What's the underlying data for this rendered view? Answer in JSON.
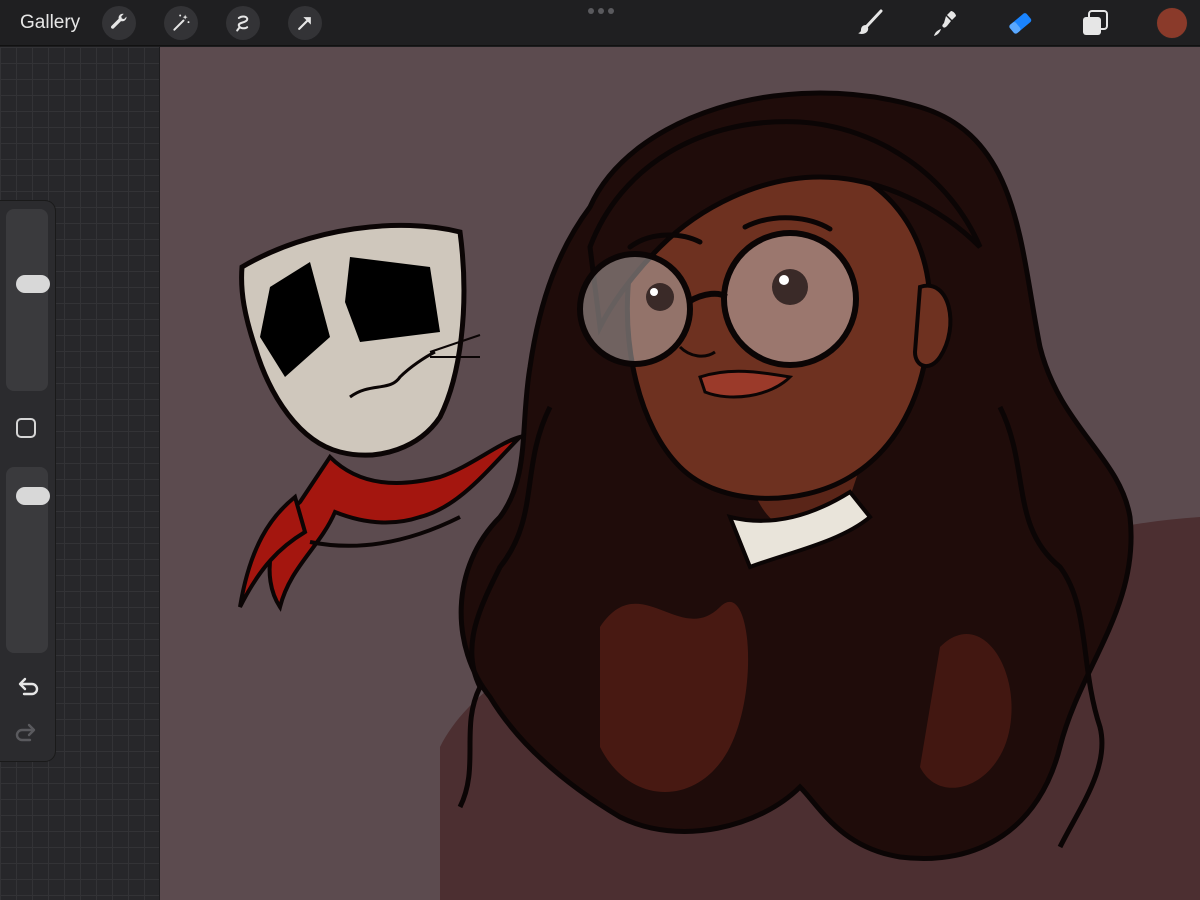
{
  "toolbar": {
    "gallery_label": "Gallery",
    "left_tools": [
      "wrench-icon",
      "magic-wand-icon",
      "selection-icon",
      "transform-arrow-icon"
    ],
    "right_tools": [
      "brush-icon",
      "smudge-icon",
      "eraser-icon",
      "layers-icon"
    ],
    "active_tool": "eraser-icon",
    "active_color": "#8a3a2a"
  },
  "sidebar": {
    "brush_size_level": 0.6,
    "opacity_level": 0.9,
    "icons": [
      "modify-square-icon",
      "undo-icon",
      "redo-icon"
    ]
  },
  "colors": {
    "canvas_background": "#5c4b4f",
    "accent_active": "#1a84ff",
    "hair": "#1f0c0a",
    "skin": "#6e3120",
    "scarf": "#a4160f",
    "mask": "#cfc7bc"
  }
}
